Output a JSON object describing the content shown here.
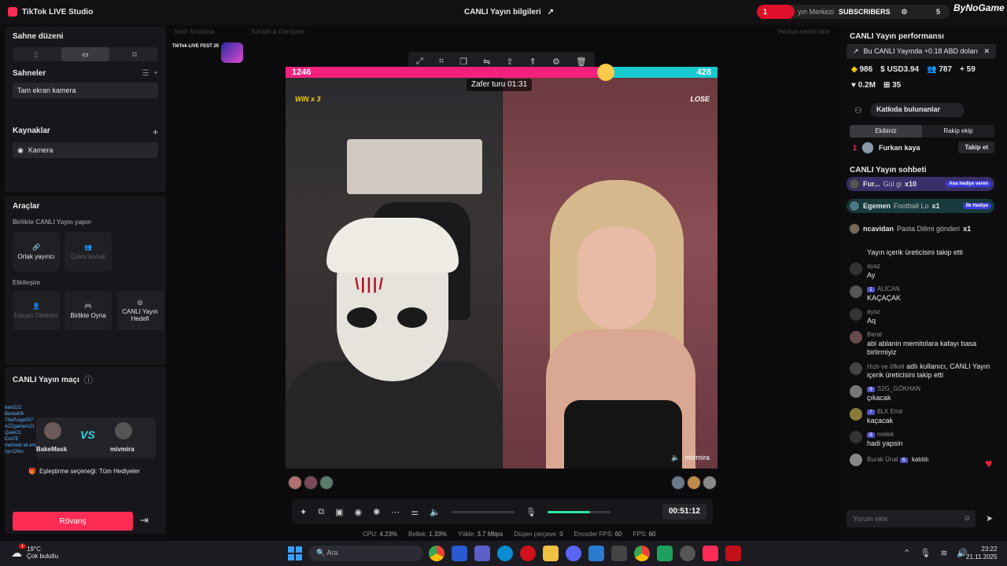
{
  "app": {
    "title": "TikTok LIVE Studio",
    "live_info": "CANLI Yayın bilgileri",
    "subscribe_label": "SUBSCRIBERS",
    "sub_count": "5",
    "sub_prefix": "1",
    "live_center": "yın Merkezi",
    "brand": "ByNoGame"
  },
  "left": {
    "scene_layout_title": "Sahne düzeni",
    "scenes_title": "Sahneler",
    "scene_item": "Tam ekran kamera",
    "sources_title": "Kaynaklar",
    "source_item": "Kamera",
    "tools_title": "Araçlar",
    "collab_sub": "Birlikte CANLI Yayın yapın",
    "collab_tools": [
      "Ortak yayıncı",
      "Çoklu konuk"
    ],
    "interaction_sub": "Etkileşim",
    "interaction_tools": [
      "İzleyici Dilekleri",
      "Birlikte Oyna",
      "CANLI Yayın Hedefi"
    ],
    "match_title": "CANLI Yayın maçı",
    "match_left": "BakeMask",
    "match_right": "mivmira",
    "match_setting": "Eşleştirme seçeneği: Tüm Hediyeler",
    "rovans_label": "Rövanş",
    "overlay_users": [
      "best222",
      "Berkat06",
      "ThePurge007",
      "AZZgamers21",
      "Quek21",
      "Emi7E",
      "mehmet ali erbil mantığı de",
      "cyn12lkn"
    ]
  },
  "center": {
    "faded_tabs": [
      "Sesli Sıralama",
      "Sohbet & Görüşme",
      "Hediye hedefi ekle"
    ],
    "livefest": "TikTok LIVE FEST 25",
    "score_left": "1246",
    "score_right": "428",
    "win_label": "WIN x 3",
    "lose_label": "LOSE",
    "round_label": "Zafer turu 01:31",
    "mask_text": "\\|||/",
    "opponent_name": "mivmira",
    "timer": "00:51:12",
    "stats": [
      {
        "label": "CPU:",
        "value": "4.23%"
      },
      {
        "label": "Bellek:",
        "value": "1.33%"
      },
      {
        "label": "Yükle:",
        "value": "3.7 Mbps"
      },
      {
        "label": "Düşen çerçeve:",
        "value": "0"
      },
      {
        "label": "Encoder FPS:",
        "value": "60"
      },
      {
        "label": "FPS:",
        "value": "60"
      }
    ],
    "mic_level": 0.68
  },
  "right": {
    "perf_title": "CANLI Yayın performansı",
    "bubble_text": "Bu CANLI Yayında +0.18 ABD doları",
    "metric_1": "986",
    "metric_2": "USD3.94",
    "metric_3": "787",
    "metric_4": "59",
    "metric_5": "0.2M",
    "metric_6": "35",
    "contrib_label": "Katkıda bulunanlar",
    "team_tabs": [
      "Ekibiniz",
      "Rakip ekip"
    ],
    "top_gifter_rank": "1",
    "top_gifter_name": "Furkan kaya",
    "follow_label": "Takip et",
    "chat_title": "CANLI Yayın sohbeti",
    "gifts": [
      {
        "user": "Fur...",
        "gift": "Gül gi",
        "count": "x10",
        "tag": "Ana hediye veren"
      },
      {
        "user": "Egemen",
        "gift": "Football Lo",
        "count": "x1",
        "tag": "İlk Hediye"
      },
      {
        "user": "ncavidan",
        "gift": "Pasta Dilimi gönderi",
        "count": "x1",
        "tag": ""
      }
    ],
    "messages": [
      {
        "name": "",
        "text": "Yayın içerik üreticisini takip etti",
        "level": ""
      },
      {
        "name": "ayaz",
        "text": "Ay",
        "level": ""
      },
      {
        "name": "ALİCAN",
        "text": "KAÇAÇAK",
        "level": "1"
      },
      {
        "name": "ayaz",
        "text": "Aq",
        "level": ""
      },
      {
        "name": "Berat",
        "text": "abi ablanin memitolara kafayı basa birlirmiyiz",
        "level": ""
      },
      {
        "name": "Hızlı ve öfkeli",
        "text": "adlı kullanıcı, CANLI Yayın içerik üreticisini takip etti",
        "level": ""
      },
      {
        "name": "S2G_GÖKHAN",
        "text": "çıkacak",
        "level": "9"
      },
      {
        "name": "8LX Emir",
        "text": "kaçacak",
        "level": "7"
      },
      {
        "name": "melek",
        "text": "hadi yapsin",
        "level": "8"
      },
      {
        "name": "Burak Ünal",
        "text": "katıldı",
        "level": "6"
      }
    ],
    "comment_placeholder": "Yorum ekle"
  },
  "taskbar": {
    "temp": "19°C",
    "weather": "Çok bulutlu",
    "weather_badge": "1",
    "search": "Ara",
    "time": "23:22",
    "date": "21.11.2025"
  }
}
